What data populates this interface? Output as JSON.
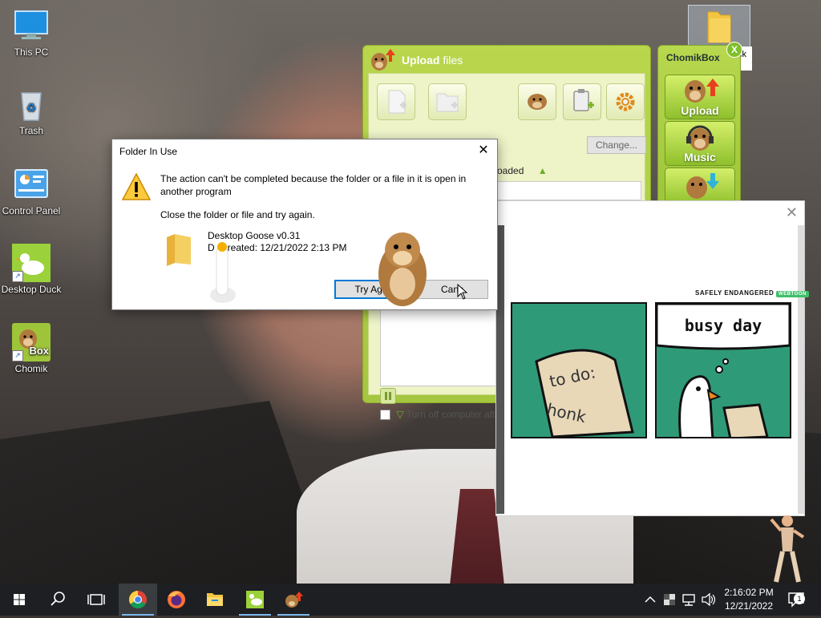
{
  "desktop": {
    "icons": [
      {
        "label": "This PC"
      },
      {
        "label": "Trash"
      },
      {
        "label": "Control Panel"
      },
      {
        "label": "Desktop Duck"
      },
      {
        "label": "Chomik"
      }
    ],
    "chomik_badge": "Box",
    "corner_fragment": "ck"
  },
  "chomikbox_sidebar": {
    "title_plain": "Chomik",
    "title_bold": "Box",
    "close_label": "X",
    "buttons": [
      {
        "label": "Upload"
      },
      {
        "label": "Music"
      }
    ]
  },
  "upload_window": {
    "title_bold": "Upload",
    "title_rest": "files",
    "change_button": "Change...",
    "column_header": "oaded",
    "turn_off_label": "Turn off computer after f"
  },
  "dialog": {
    "title": "Folder In Use",
    "close_label": "✕",
    "message": "The action can't be completed because the folder or a file in it is open in another program",
    "instruction": "Close the folder or file and try again.",
    "file_name": "Desktop Goose v0.31",
    "date_created": "D   created: 12/21/2022 2:13 PM",
    "try_again_button": "Try Aga",
    "cancel_button": "Canc"
  },
  "comic": {
    "close_label": "✕",
    "header": "SAFELY ENDANGERED",
    "header_tag": "WEBTOON",
    "panel1_text_line1": "to do:",
    "panel1_text_line2": "honk",
    "panel2_text": "busy day"
  },
  "taskbar": {
    "clock_time": "2:16:02 PM",
    "clock_date": "12/21/2022",
    "notification_count": "1"
  },
  "colors": {
    "chomik_green": "#a5c63f",
    "taskbar_bg": "#1d1f22",
    "comic_green": "#2f9a78",
    "accent_blue": "#0078d7"
  }
}
